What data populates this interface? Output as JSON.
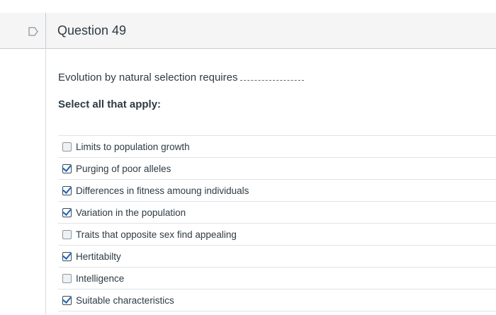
{
  "question": {
    "title": "Question 49",
    "prompt": "Evolution by natural selection requires",
    "instruction": "Select all that apply:"
  },
  "options": [
    {
      "label": "Limits to population growth",
      "checked": false
    },
    {
      "label": "Purging of poor alleles",
      "checked": true
    },
    {
      "label": "Differences in fitness amoung individuals",
      "checked": true
    },
    {
      "label": "Variation in the population",
      "checked": true
    },
    {
      "label": "Traits that opposite sex find appealing",
      "checked": false
    },
    {
      "label": "Hertitabilty",
      "checked": true
    },
    {
      "label": "Intelligence",
      "checked": false
    },
    {
      "label": "Suitable characteristics",
      "checked": true
    }
  ]
}
